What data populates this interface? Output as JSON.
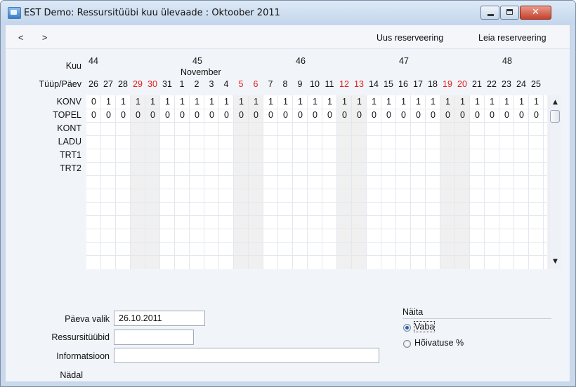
{
  "window": {
    "title": "EST Demo: Ressursitüübi kuu ülevaade : Oktoober 2011",
    "close_glyph": "✕"
  },
  "toolbar": {
    "prev": "<",
    "next": ">",
    "new_reservation": "Uus reserveering",
    "find_reservation": "Leia reserveering"
  },
  "grid": {
    "week_label": "Kuu",
    "day_label": "Tüüp/Päev",
    "weeks": [
      "44",
      "45",
      "46",
      "47",
      "48"
    ],
    "month": "November",
    "days": [
      "26",
      "27",
      "28",
      "29",
      "30",
      "31",
      "1",
      "2",
      "3",
      "4",
      "5",
      "6",
      "7",
      "8",
      "9",
      "10",
      "11",
      "12",
      "13",
      "14",
      "15",
      "16",
      "17",
      "18",
      "19",
      "20",
      "21",
      "22",
      "23",
      "24",
      "25"
    ],
    "weekend_days": [
      3,
      4,
      10,
      11,
      17,
      18,
      24,
      25
    ],
    "resource_types": [
      {
        "name": "KONV",
        "values": [
          "0",
          "1",
          "1",
          "1",
          "1",
          "1",
          "1",
          "1",
          "1",
          "1",
          "1",
          "1",
          "1",
          "1",
          "1",
          "1",
          "1",
          "1",
          "1",
          "1",
          "1",
          "1",
          "1",
          "1",
          "1",
          "1",
          "1",
          "1",
          "1",
          "1",
          "1"
        ]
      },
      {
        "name": "TOPEL",
        "values": [
          "0",
          "0",
          "0",
          "0",
          "0",
          "0",
          "0",
          "0",
          "0",
          "0",
          "0",
          "0",
          "0",
          "0",
          "0",
          "0",
          "0",
          "0",
          "0",
          "0",
          "0",
          "0",
          "0",
          "0",
          "0",
          "0",
          "0",
          "0",
          "0",
          "0",
          "0"
        ]
      },
      {
        "name": "KONT",
        "values": []
      },
      {
        "name": "LADU",
        "values": []
      },
      {
        "name": "TRT1",
        "values": []
      },
      {
        "name": "TRT2",
        "values": []
      }
    ],
    "weekend_color": "#e0201c"
  },
  "scrollbar": {
    "up": "▲",
    "down": "▼"
  },
  "form": {
    "date_label": "Päeva valik",
    "date_value": "26.10.2011",
    "types_label": "Ressursitüübid",
    "types_value": "",
    "info_label": "Informatsioon",
    "info_value": "",
    "week_label": "Nädal"
  },
  "display": {
    "label": "Näita",
    "options": [
      "Vaba",
      "Hõivatuse %"
    ],
    "selected": "Vaba"
  }
}
